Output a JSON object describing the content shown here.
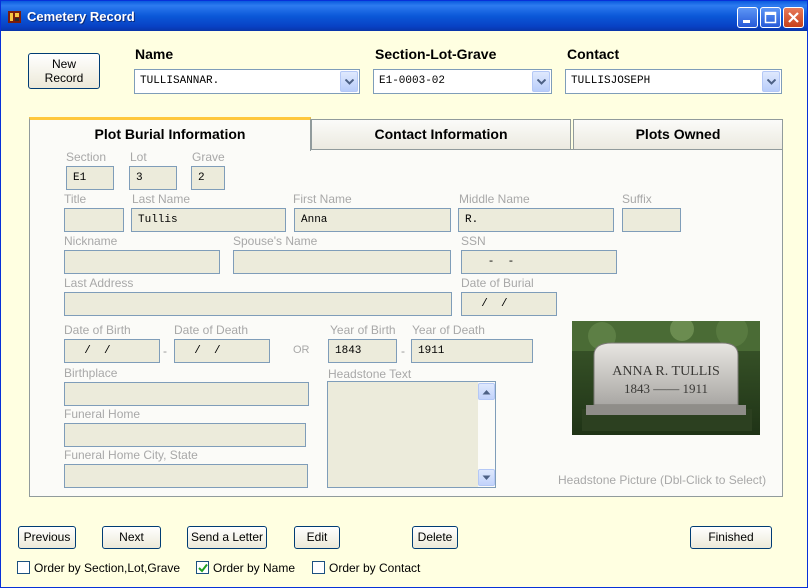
{
  "window": {
    "title": "Cemetery Record",
    "minimize_icon": "minimize-icon",
    "maximize_icon": "maximize-icon",
    "close_icon": "close-icon"
  },
  "header": {
    "new_record_line1": "New",
    "new_record_line2": "Record",
    "name_label": "Name",
    "name_value": "TULLISANNAR.",
    "section_label": "Section-Lot-Grave",
    "section_value": "E1-0003-02",
    "contact_label": "Contact",
    "contact_value": "TULLISJOSEPH"
  },
  "tabs": [
    {
      "label": "Plot Burial Information",
      "active": true
    },
    {
      "label": "Contact Information",
      "active": false
    },
    {
      "label": "Plots Owned",
      "active": false
    }
  ],
  "form": {
    "section": {
      "label": "Section",
      "value": "E1"
    },
    "lot": {
      "label": "Lot",
      "value": "3"
    },
    "grave": {
      "label": "Grave",
      "value": "2"
    },
    "title": {
      "label": "Title",
      "value": ""
    },
    "last_name": {
      "label": "Last Name",
      "value": "Tullis"
    },
    "first_name": {
      "label": "First Name",
      "value": "Anna"
    },
    "middle_name": {
      "label": "Middle Name",
      "value": "R."
    },
    "suffix": {
      "label": "Suffix",
      "value": ""
    },
    "nickname": {
      "label": "Nickname",
      "value": ""
    },
    "spouse_name": {
      "label": "Spouse's Name",
      "value": ""
    },
    "ssn": {
      "label": "SSN",
      "value": "   -  -"
    },
    "last_address": {
      "label": "Last Address",
      "value": ""
    },
    "date_of_burial": {
      "label": "Date of Burial",
      "value": "  /  /"
    },
    "date_of_birth": {
      "label": "Date of Birth",
      "value": "  /  /"
    },
    "date_of_death": {
      "label": "Date of Death",
      "value": "  /  /"
    },
    "or_text": "OR",
    "year_of_birth": {
      "label": "Year of Birth",
      "value": "1843"
    },
    "year_of_death": {
      "label": "Year of Death",
      "value": "1911"
    },
    "range_dash": "-",
    "birthplace": {
      "label": "Birthplace",
      "value": ""
    },
    "headstone_text": {
      "label": "Headstone Text",
      "value": ""
    },
    "funeral_home": {
      "label": "Funeral Home",
      "value": ""
    },
    "funeral_home_city": {
      "label": "Funeral Home City, State",
      "value": ""
    },
    "headstone_caption": "Headstone Picture (Dbl-Click to Select)",
    "headstone_inscription_name": "ANNA R. TULLIS",
    "headstone_inscription_years": "1843 —— 1911"
  },
  "buttons": {
    "previous": "Previous",
    "next": "Next",
    "send_letter": "Send a Letter",
    "edit": "Edit",
    "delete": "Delete",
    "finished": "Finished"
  },
  "order_options": [
    {
      "label": "Order by Section,Lot,Grave",
      "checked": false
    },
    {
      "label": "Order by Name",
      "checked": true
    },
    {
      "label": "Order by Contact",
      "checked": false
    }
  ],
  "colors": {
    "background": "#ffffe1",
    "titlebar": "#0a5bde",
    "field_fill": "#ecebdb",
    "label_gray": "#a8a8a8",
    "active_tab_accent": "#ffc83c"
  }
}
